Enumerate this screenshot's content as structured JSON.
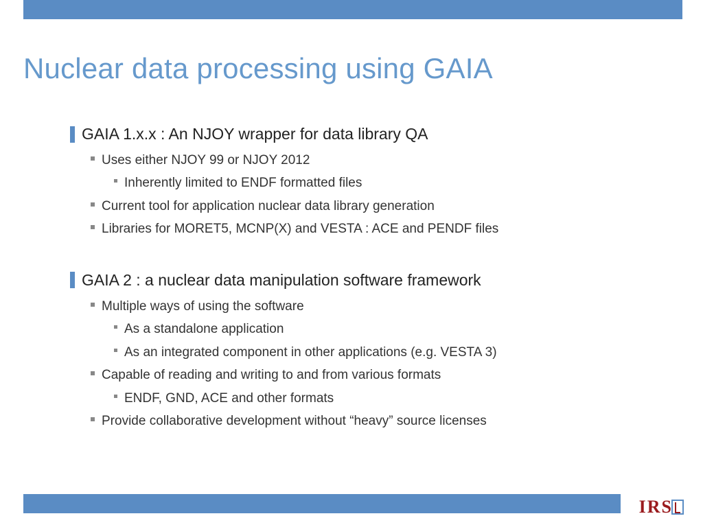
{
  "title": "Nuclear data processing using GAIA",
  "sections": [
    {
      "heading": "GAIA 1.x.x : An NJOY wrapper for data library QA",
      "items": [
        {
          "text": "Uses either NJOY 99 or NJOY 2012",
          "sub": [
            "Inherently limited to ENDF formatted files"
          ]
        },
        {
          "text": "Current tool for application nuclear data library generation"
        },
        {
          "text": "Libraries for MORET5, MCNP(X) and VESTA : ACE and PENDF files"
        }
      ]
    },
    {
      "heading": "GAIA 2 : a nuclear data manipulation software framework",
      "items": [
        {
          "text": "Multiple ways of using the software",
          "sub": [
            "As a standalone application",
            "As an integrated component in other applications (e.g. VESTA 3)"
          ]
        },
        {
          "text": "Capable of reading and writing to and from various formats",
          "sub": [
            "ENDF, GND, ACE and other formats"
          ]
        },
        {
          "text": "Provide collaborative development without “heavy” source licenses"
        }
      ]
    }
  ],
  "logo": "IRS"
}
